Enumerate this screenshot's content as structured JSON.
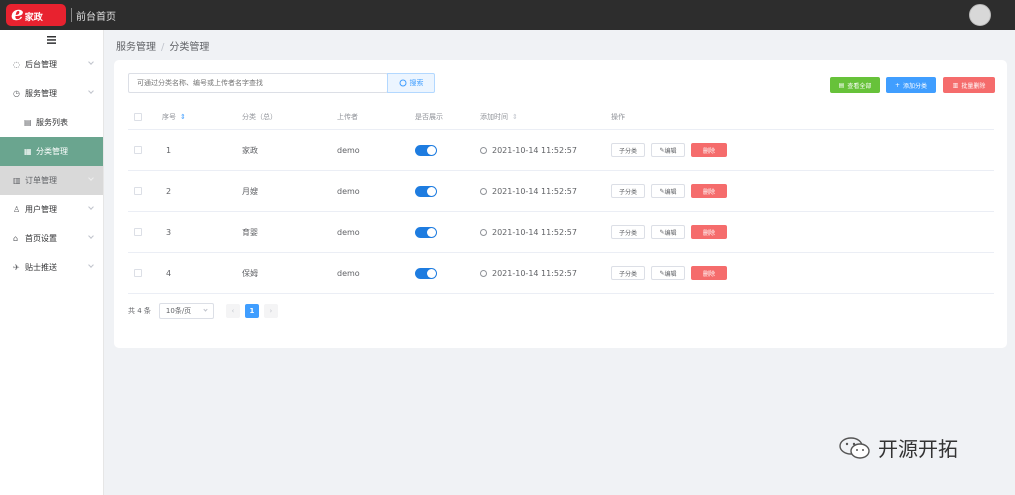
{
  "topbar": {
    "logo_letter": "e",
    "logo_text": "家政",
    "home_link": "前台首页"
  },
  "sidebar": {
    "items": [
      {
        "label": "后台管理",
        "icon": "home-icon",
        "glyph": "◌"
      },
      {
        "label": "服务管理",
        "icon": "clock-icon",
        "glyph": "◷"
      },
      {
        "label": "服务列表",
        "icon": "document-icon",
        "glyph": "▤"
      },
      {
        "label": "分类管理",
        "icon": "grid-icon",
        "glyph": "▦"
      },
      {
        "label": "订单管理",
        "icon": "order-icon",
        "glyph": "▥"
      },
      {
        "label": "用户管理",
        "icon": "user-icon",
        "glyph": "♙"
      },
      {
        "label": "首页设置",
        "icon": "house-icon",
        "glyph": "⌂"
      },
      {
        "label": "贴士推送",
        "icon": "send-icon",
        "glyph": "✈"
      }
    ]
  },
  "breadcrumb": {
    "parent": "服务管理",
    "separator": "/",
    "current": "分类管理"
  },
  "search": {
    "placeholder": "可通过分类名称、编号或上传者名字查找",
    "button": "搜索"
  },
  "toolbar": {
    "view_all": "查看全部",
    "add": "添加分类",
    "batch_delete": "批量删除"
  },
  "table": {
    "headers": {
      "id": "序号",
      "name": "分类（总）",
      "uploader": "上传者",
      "visible": "是否展示",
      "time": "添加时间",
      "ops": "操作"
    },
    "rows": [
      {
        "id": "1",
        "name": "家政",
        "uploader": "demo",
        "visible": true,
        "time": "2021-10-14 11:52:57"
      },
      {
        "id": "2",
        "name": "月嫂",
        "uploader": "demo",
        "visible": true,
        "time": "2021-10-14 11:52:57"
      },
      {
        "id": "3",
        "name": "育婴",
        "uploader": "demo",
        "visible": true,
        "time": "2021-10-14 11:52:57"
      },
      {
        "id": "4",
        "name": "保姆",
        "uploader": "demo",
        "visible": true,
        "time": "2021-10-14 11:52:57"
      }
    ],
    "ops": {
      "child": "子分类",
      "edit": "编辑",
      "delete": "删除"
    }
  },
  "pagination": {
    "total": "共 4 条",
    "page_size": "10条/页",
    "prev": "‹",
    "current": "1",
    "next": "›"
  },
  "watermark": {
    "text": "开源开拓"
  },
  "colors": {
    "topbar": "#2d2d2d",
    "logo": "#e8222f",
    "active_menu": "#6aa58f",
    "primary": "#409eff",
    "success": "#67c23a",
    "danger": "#f56c6c",
    "switch_on": "#1e7ce0"
  }
}
